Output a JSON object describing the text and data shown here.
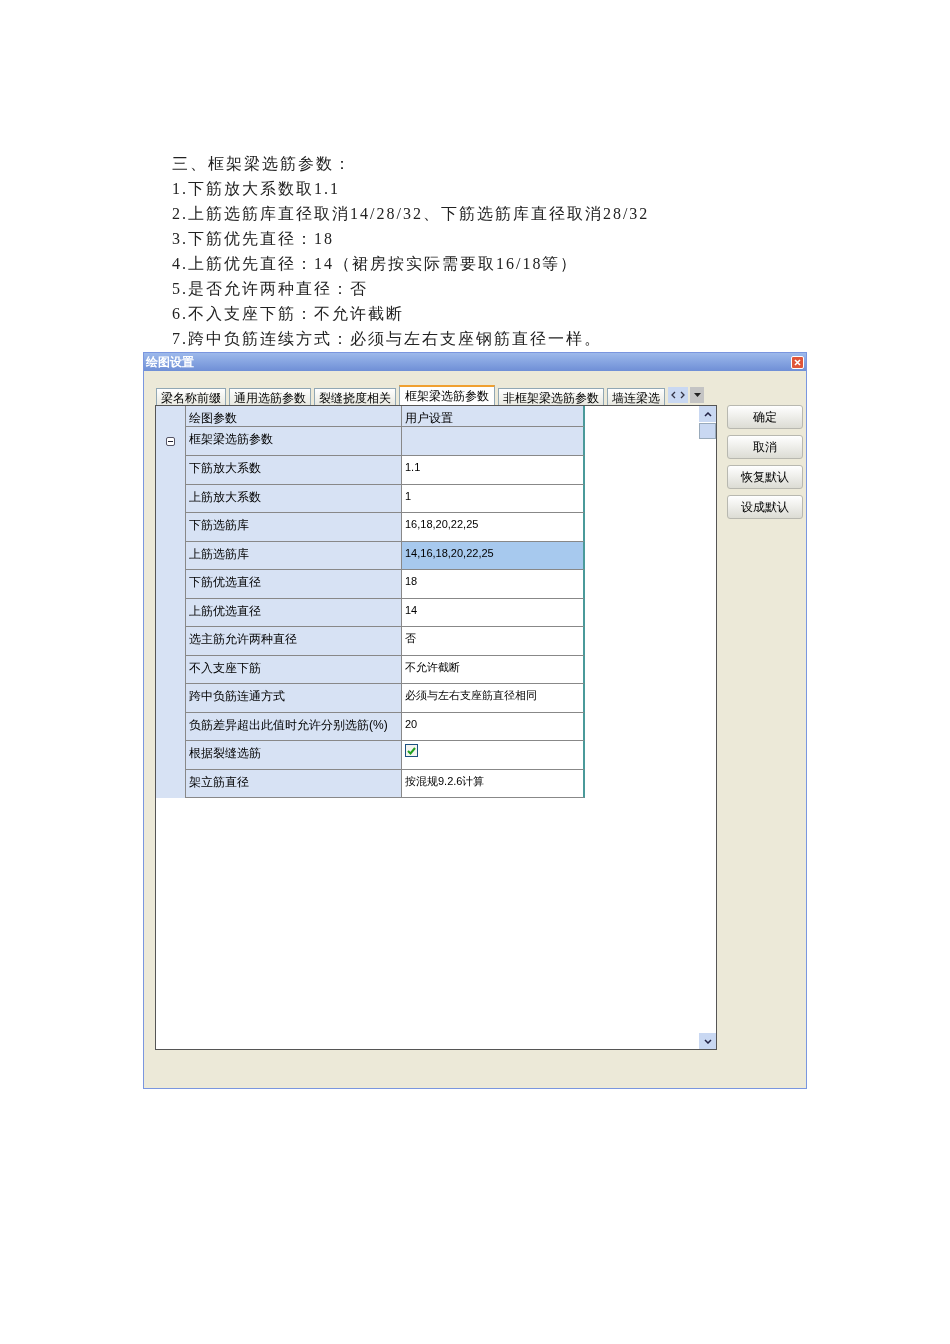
{
  "document_text": [
    "三、框架梁选筋参数：",
    "1.下筋放大系数取1.1",
    "2.上筋选筋库直径取消14/28/32、下筋选筋库直径取消28/32",
    "3.下筋优先直径：18",
    "4.上筋优先直径：14（裙房按实际需要取16/18等）",
    "5.是否允许两种直径：否",
    "6.不入支座下筋：不允许截断",
    "7.跨中负筋连续方式：必须与左右支座钢筋直径一样。"
  ],
  "window": {
    "title": "绘图设置"
  },
  "tabs": [
    {
      "label": "梁名称前缀",
      "selected": false
    },
    {
      "label": "通用选筋参数",
      "selected": false
    },
    {
      "label": "裂缝挠度相关",
      "selected": false
    },
    {
      "label": "框架梁选筋参数",
      "selected": true
    },
    {
      "label": "非框架梁选筋参数",
      "selected": false
    },
    {
      "label": "墙连梁选",
      "selected": false
    }
  ],
  "grid": {
    "columns": [
      "绘图参数",
      "用户设置"
    ],
    "group": {
      "label": "框架梁选筋参数",
      "expanded": true
    },
    "rows": [
      {
        "name": "下筋放大系数",
        "kind": "text",
        "value": "1.1",
        "selected": false
      },
      {
        "name": "上筋放大系数",
        "kind": "text",
        "value": "1",
        "selected": false
      },
      {
        "name": "下筋选筋库",
        "kind": "text",
        "value": "16,18,20,22,25",
        "selected": false
      },
      {
        "name": "上筋选筋库",
        "kind": "text",
        "value": "14,16,18,20,22,25",
        "selected": true
      },
      {
        "name": "下筋优选直径",
        "kind": "text",
        "value": "18",
        "selected": false
      },
      {
        "name": "上筋优选直径",
        "kind": "text",
        "value": "14",
        "selected": false
      },
      {
        "name": "选主筋允许两种直径",
        "kind": "text",
        "value": "否",
        "selected": false
      },
      {
        "name": "不入支座下筋",
        "kind": "text",
        "value": "不允许截断",
        "selected": false
      },
      {
        "name": "跨中负筋连通方式",
        "kind": "text",
        "value": "必须与左右支座筋直径相同",
        "selected": false
      },
      {
        "name": "负筋差异超出此值时允许分别选筋(%)",
        "kind": "text",
        "value": "20",
        "selected": false
      },
      {
        "name": "根据裂缝选筋",
        "kind": "checkbox",
        "checked": true,
        "selected": false
      },
      {
        "name": "架立筋直径",
        "kind": "text",
        "value": "按混规9.2.6计算",
        "selected": false
      }
    ]
  },
  "buttons": [
    "确定",
    "取消",
    "恢复默认",
    "设成默认"
  ]
}
